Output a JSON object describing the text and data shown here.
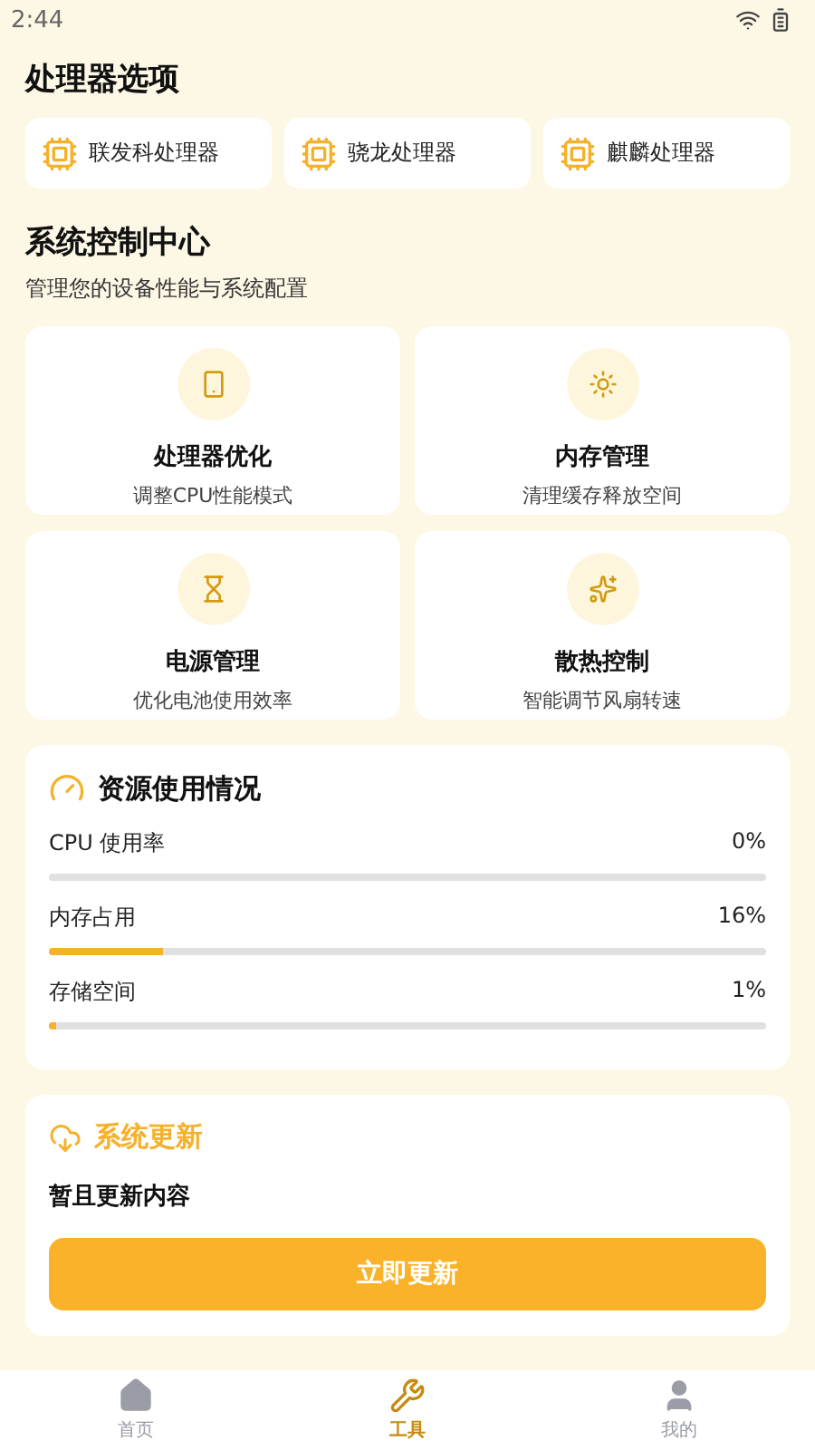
{
  "status_bar": {
    "time": "2:44"
  },
  "processor_section": {
    "title": "处理器选项",
    "items": [
      {
        "label": "联发科处理器"
      },
      {
        "label": "骁龙处理器"
      },
      {
        "label": "麒麟处理器"
      }
    ]
  },
  "control_center": {
    "title": "系统控制中心",
    "subtitle": "管理您的设备性能与系统配置",
    "cards": [
      {
        "title": "处理器优化",
        "description": "调整CPU性能模式"
      },
      {
        "title": "内存管理",
        "description": "清理缓存释放空间"
      },
      {
        "title": "电源管理",
        "description": "优化电池使用效率"
      },
      {
        "title": "散热控制",
        "description": "智能调节风扇转速"
      }
    ]
  },
  "resources": {
    "title": "资源使用情况",
    "meters": [
      {
        "label": "CPU 使用率",
        "reading": "0%",
        "level": 0
      },
      {
        "label": "内存占用",
        "reading": "16%",
        "level": 0.16
      },
      {
        "label": "存储空间",
        "reading": "1%",
        "level": 0.01
      }
    ]
  },
  "update": {
    "title": "系统更新",
    "message": "暂且更新内容",
    "button": "立即更新"
  },
  "bottom_nav": [
    {
      "label": "首页",
      "selected": false
    },
    {
      "label": "工具",
      "selected": true
    },
    {
      "label": "我的",
      "selected": false
    }
  ]
}
